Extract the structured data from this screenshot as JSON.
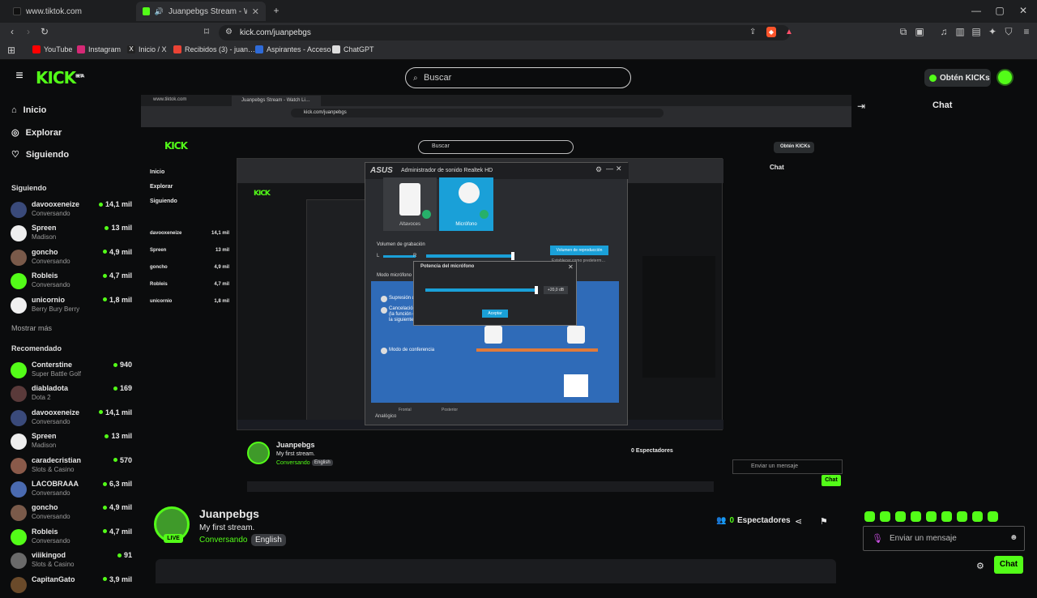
{
  "browser": {
    "tabs": [
      {
        "title": "www.tiktok.com",
        "active": false
      },
      {
        "title": "Juanpebgs Stream - Watch Li…",
        "active": true
      }
    ],
    "url": "kick.com/juanpebgs",
    "bookmarks": [
      {
        "label": "YouTube",
        "color": "#ff0000"
      },
      {
        "label": "Instagram",
        "color": "#d62976"
      },
      {
        "label": "Inicio / X",
        "color": "#ffffff"
      },
      {
        "label": "Recibidos (3) - juan…",
        "color": "#ea4335"
      },
      {
        "label": "Aspirantes - Acceso",
        "color": "#2f6bd8"
      },
      {
        "label": "ChatGPT",
        "color": "#dddddd"
      }
    ]
  },
  "header": {
    "logo": "KICK",
    "beta": "BETA",
    "search_placeholder": "Buscar",
    "kicks_label": "Obtén KICKs"
  },
  "sidebar": {
    "nav": [
      {
        "label": "Inicio",
        "icon": "home-icon"
      },
      {
        "label": "Explorar",
        "icon": "compass-icon"
      },
      {
        "label": "Siguiendo",
        "icon": "heart-icon"
      }
    ],
    "following_title": "Siguiendo",
    "following": [
      {
        "name": "davooxeneize",
        "cat": "Conversando",
        "viewers": "14,1 mil",
        "color": "#3a4a7a"
      },
      {
        "name": "Spreen",
        "cat": "Madison",
        "viewers": "13 mil",
        "color": "#eeeeee"
      },
      {
        "name": "goncho",
        "cat": "Conversando",
        "viewers": "4,9 mil",
        "color": "#7a5a4a"
      },
      {
        "name": "Robleis",
        "cat": "Conversando",
        "viewers": "4,7 mil",
        "color": "#53fc18"
      },
      {
        "name": "unicornio",
        "cat": "Berry Bury Berry",
        "viewers": "1,8 mil",
        "color": "#f0f0f0"
      }
    ],
    "show_more": "Mostrar más",
    "recommended_title": "Recomendado",
    "recommended": [
      {
        "name": "Conterstine",
        "cat": "Super Battle Golf",
        "viewers": "940",
        "color": "#53fc18"
      },
      {
        "name": "diabladota",
        "cat": "Dota 2",
        "viewers": "169",
        "color": "#5a3a3a"
      },
      {
        "name": "davooxeneize",
        "cat": "Conversando",
        "viewers": "14,1 mil",
        "color": "#3a4a7a"
      },
      {
        "name": "Spreen",
        "cat": "Madison",
        "viewers": "13 mil",
        "color": "#eeeeee"
      },
      {
        "name": "caradecristian",
        "cat": "Slots & Casino",
        "viewers": "570",
        "color": "#8a5a4a"
      },
      {
        "name": "LACOBRAAA",
        "cat": "Conversando",
        "viewers": "6,3 mil",
        "color": "#4a6ab0"
      },
      {
        "name": "goncho",
        "cat": "Conversando",
        "viewers": "4,9 mil",
        "color": "#7a5a4a"
      },
      {
        "name": "Robleis",
        "cat": "Conversando",
        "viewers": "4,7 mil",
        "color": "#53fc18"
      },
      {
        "name": "viiikingod",
        "cat": "Slots & Casino",
        "viewers": "91",
        "color": "#6a6a6a"
      },
      {
        "name": "CapitanGato",
        "cat": "",
        "viewers": "3,9 mil",
        "color": "#6a4a2a"
      }
    ]
  },
  "stream": {
    "channel": "Juanpebgs",
    "title": "My first stream.",
    "category": "Conversando",
    "language": "English",
    "live": "LIVE",
    "viewers_count": "0",
    "viewers_label": "Espectadores"
  },
  "chat": {
    "title": "Chat",
    "input_placeholder": "Enviar un mensaje",
    "send_label": "Chat"
  },
  "realtek": {
    "brand": "ASUS",
    "title": "Administrador de sonido Realtek HD",
    "tab_speakers": "Altavoces",
    "tab_mic": "Micrófono",
    "rec_volume": "Volumen de grabación",
    "playback_btn": "Volumen de reproducción",
    "default_device": "Establecer como predeterm…",
    "mode_label": "Modo micrófono",
    "opt1": "Supresión de",
    "opt2": "Cancelación de",
    "opt2b": "(la función d",
    "opt2c": "la siguiente c",
    "opt3": "Modo de conferencia",
    "analog": "Analógico",
    "front": "Frontal",
    "rear": "Posterior",
    "l": "L",
    "r": "R"
  },
  "mic_dialog": {
    "title": "Potencia del micrófono",
    "value": "+20,0 dB",
    "boost_fraction": 1.0,
    "ok": "Aceptar"
  },
  "colors": {
    "kick_green": "#53fc18",
    "bg": "#0b0c0d",
    "realtek_blue": "#2f6bb8",
    "accent_cyan": "#1aa0d8"
  }
}
